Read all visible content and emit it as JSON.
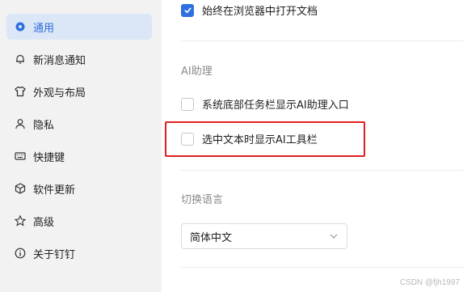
{
  "sidebar": {
    "items": [
      {
        "label": "通用",
        "icon": "general-icon",
        "active": true
      },
      {
        "label": "新消息通知",
        "icon": "bell-icon"
      },
      {
        "label": "外观与布局",
        "icon": "shirt-icon"
      },
      {
        "label": "隐私",
        "icon": "person-icon"
      },
      {
        "label": "快捷键",
        "icon": "keyboard-icon"
      },
      {
        "label": "软件更新",
        "icon": "cube-icon"
      },
      {
        "label": "高级",
        "icon": "star-icon"
      },
      {
        "label": "关于钉钉",
        "icon": "info-icon"
      }
    ]
  },
  "main": {
    "open_in_browser": {
      "label": "始终在浏览器中打开文档",
      "checked": true
    },
    "ai_section": {
      "title": "AI助理",
      "taskbar_option": {
        "label": "系统底部任务栏显示AI助理入口",
        "checked": false
      },
      "toolbar_option": {
        "label": "选中文本时显示AI工具栏",
        "checked": false
      }
    },
    "language_section": {
      "title": "切换语言",
      "selected": "简体中文"
    }
  },
  "watermark": "CSDN @fjh1997",
  "colors": {
    "accent": "#2f6fe0",
    "highlight": "#e02020",
    "sidebar_bg": "#f2f2f3",
    "active_bg": "#dbe6f6"
  }
}
